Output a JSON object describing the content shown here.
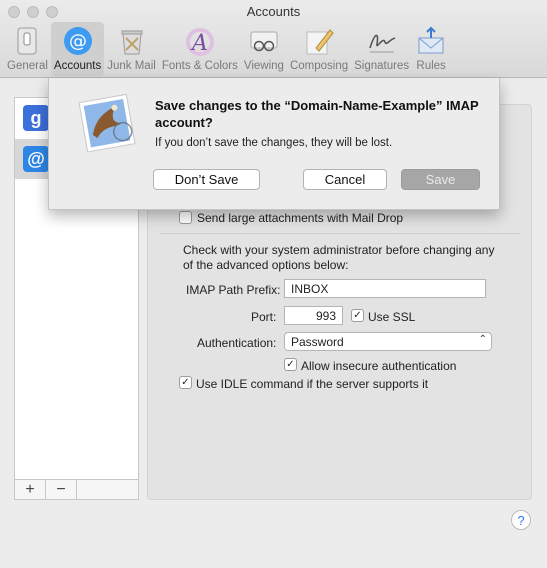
{
  "window": {
    "title": "Accounts"
  },
  "toolbar": {
    "items": [
      {
        "label": "General",
        "icon": "general-switch-icon"
      },
      {
        "label": "Accounts",
        "icon": "at-sign-icon"
      },
      {
        "label": "Junk Mail",
        "icon": "trash-bin-icon"
      },
      {
        "label": "Fonts & Colors",
        "icon": "font-icon"
      },
      {
        "label": "Viewing",
        "icon": "glasses-icon"
      },
      {
        "label": "Composing",
        "icon": "pencil-icon"
      },
      {
        "label": "Signatures",
        "icon": "signature-icon"
      },
      {
        "label": "Rules",
        "icon": "envelope-arrows-icon"
      }
    ],
    "active_index": 1
  },
  "sidebar": {
    "accounts": [
      {
        "icon": "google-icon",
        "glyph": "g",
        "color": "#3b6fd9"
      },
      {
        "icon": "at-sign-icon",
        "glyph": "@",
        "color": "#2d86e6"
      }
    ],
    "add_label": "+",
    "remove_label": "−"
  },
  "settings": {
    "mail_drop_label": "Send large attachments with Mail Drop",
    "mail_drop_checked": false,
    "advanced_note_line1": "Check with your system administrator before changing any",
    "advanced_note_line2": "of the advanced options below:",
    "imap_path_label": "IMAP Path Prefix:",
    "imap_path_value": "INBOX",
    "port_label": "Port:",
    "port_value": "993",
    "use_ssl_label": "Use SSL",
    "use_ssl_checked": true,
    "auth_label": "Authentication:",
    "auth_value": "Password",
    "insecure_auth_label": "Allow insecure authentication",
    "insecure_auth_checked": true,
    "idle_label": "Use IDLE command if the server supports it",
    "idle_checked": true
  },
  "help_label": "?",
  "dialog": {
    "title": "Save changes to the “Domain-Name-Example” IMAP account?",
    "message": "If you don’t save the changes, they will be lost.",
    "dont_save_label": "Don’t Save",
    "cancel_label": "Cancel",
    "save_label": "Save",
    "icon": "mail-stamp-eagle-icon"
  }
}
